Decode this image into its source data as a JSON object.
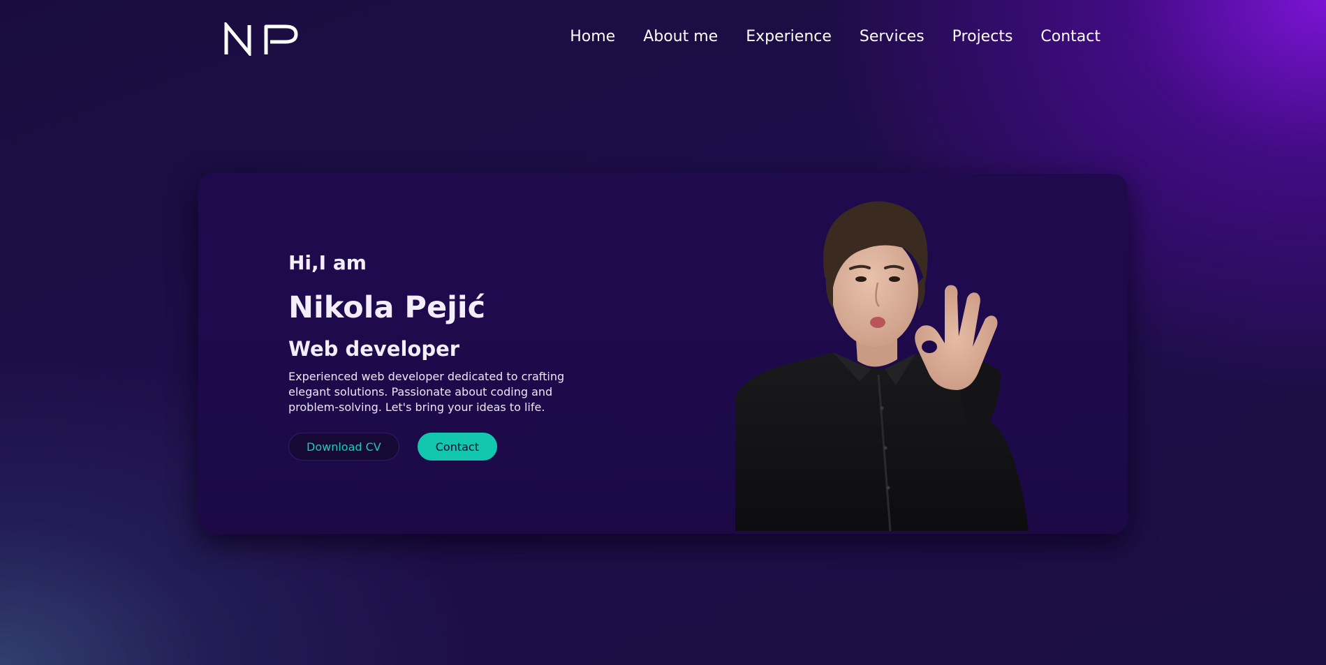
{
  "header": {
    "logo_text": "NP",
    "nav": [
      {
        "label": "Home"
      },
      {
        "label": "About me"
      },
      {
        "label": "Experience"
      },
      {
        "label": "Services"
      },
      {
        "label": "Projects"
      },
      {
        "label": "Contact"
      }
    ]
  },
  "hero": {
    "greeting": "Hi,I am",
    "name": "Nikola Pejić",
    "role": "Web developer",
    "bio": "Experienced web developer dedicated to crafting elegant solutions. Passionate about coding and problem-solving. Let's bring your ideas to life.",
    "download_cv_label": "Download CV",
    "contact_label": "Contact",
    "portrait_alt": "Nikola Pejić"
  },
  "colors": {
    "accent": "#12c7ad",
    "card_background": "#1f0a4d",
    "page_background": "#190c3c",
    "glow_top_right": "#8014dc"
  }
}
